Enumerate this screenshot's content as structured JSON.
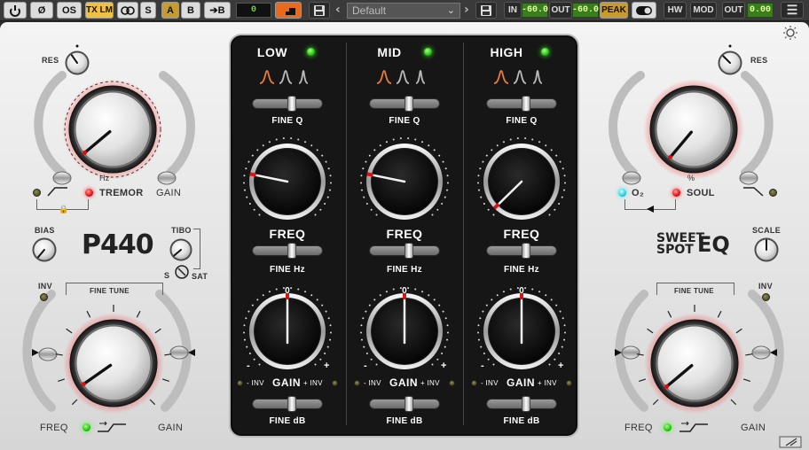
{
  "toolbar": {
    "power_icon": "power-icon",
    "phase_label": "Ø",
    "os_label": "OS",
    "tx_label": "TX LM",
    "link_icon": "stereo-link-icon",
    "s_label": "S",
    "a_label": "A",
    "b_label": "B",
    "copy_label": "➔B",
    "counter_value": "0",
    "save_icon": "save-icon",
    "preset_name": "Default",
    "in_label": "IN",
    "in_value": "-60.0",
    "out_label": "OUT",
    "out_value": "-60.0",
    "peak_label": "PEAK",
    "toggle_icon": "toggle-icon",
    "hw_label": "HW",
    "mod_label": "MOD",
    "out_meter_label": "OUT",
    "out_meter_value": "0.00",
    "menu_icon": "hamburger-menu-icon",
    "theme_icon": "sun-icon"
  },
  "left": {
    "res_label": "RES",
    "hz_label": "Hz",
    "tremor_label": "TREMOR",
    "gain_label": "GAIN",
    "bias_label": "BIAS",
    "brand": "P440",
    "tibo_label": "TIBO",
    "s_label": "S",
    "sat_label": "SAT",
    "inv_label": "INV",
    "fine_tune_label": "FINE TUNE",
    "freq_label": "FREQ",
    "gain2_label": "GAIN"
  },
  "right": {
    "res_label": "RES",
    "percent_label": "%",
    "o2_label": "O₂",
    "soul_label": "SOUL",
    "brand_line1": "SWEET",
    "brand_line2": "SPOT",
    "brand_eq": "EQ",
    "scale_label": "SCALE",
    "inv_label": "INV",
    "fine_tune_label": "FINE TUNE",
    "freq_label": "FREQ",
    "gain_label": "GAIN"
  },
  "bands": [
    {
      "name": "LOW",
      "fine_q": "FINE Q",
      "freq": "FREQ",
      "fine_hz": "FINE Hz",
      "zero": "0",
      "minus": "-",
      "plus": "+",
      "inv_minus": "- INV",
      "gain": "GAIN",
      "inv_plus": "+ INV",
      "fine_db": "FINE dB",
      "freq_position": 0.22,
      "gain_position": 0.5
    },
    {
      "name": "MID",
      "fine_q": "FINE Q",
      "freq": "FREQ",
      "fine_hz": "FINE Hz",
      "zero": "0",
      "minus": "-",
      "plus": "+",
      "inv_minus": "- INV",
      "gain": "GAIN",
      "inv_plus": "+ INV",
      "fine_db": "FINE dB",
      "freq_position": 0.22,
      "gain_position": 0.5
    },
    {
      "name": "HIGH",
      "fine_q": "FINE Q",
      "freq": "FREQ",
      "fine_hz": "FINE Hz",
      "zero": "0",
      "minus": "-",
      "plus": "+",
      "inv_minus": "- INV",
      "gain": "GAIN",
      "inv_plus": "+ INV",
      "fine_db": "FINE dB",
      "freq_position": 0.02,
      "gain_position": 0.5
    }
  ],
  "colors": {
    "accent_red": "#e01010",
    "led_green": "#24c40c",
    "panel": "#161616",
    "lcd_green": "#3a7d1e"
  }
}
